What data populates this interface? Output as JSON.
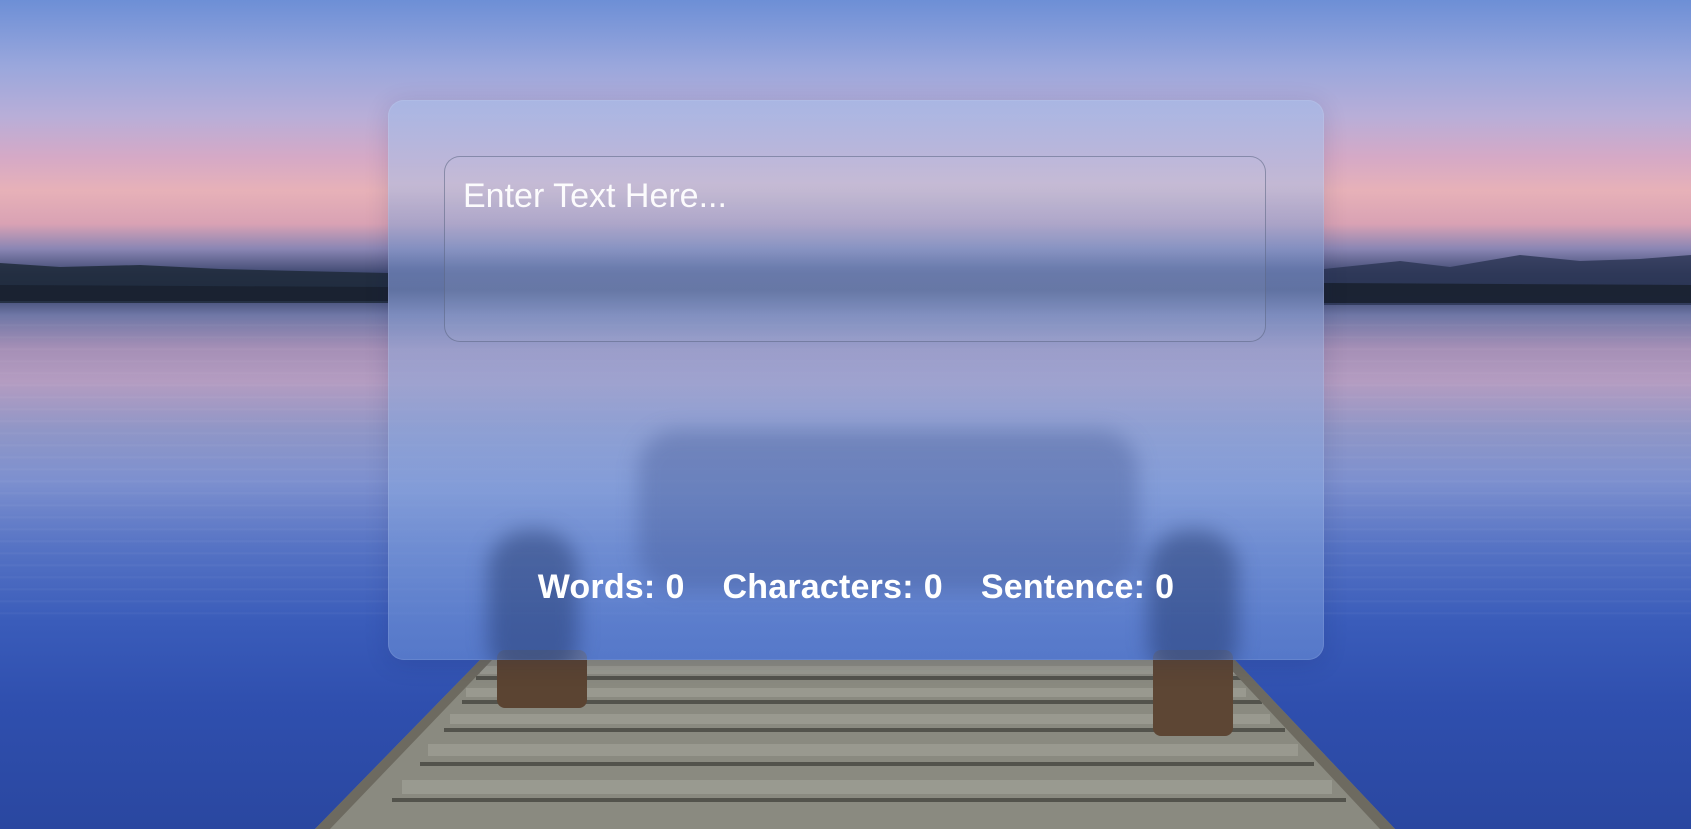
{
  "input": {
    "placeholder": "Enter Text Here..."
  },
  "stats": {
    "words_label": "Words:",
    "words_value": "0",
    "characters_label": "Characters:",
    "characters_value": "0",
    "sentence_label": "Sentence:",
    "sentence_value": "0"
  },
  "colors": {
    "text": "#ffffff",
    "card_tint": "#a0b9e6"
  }
}
